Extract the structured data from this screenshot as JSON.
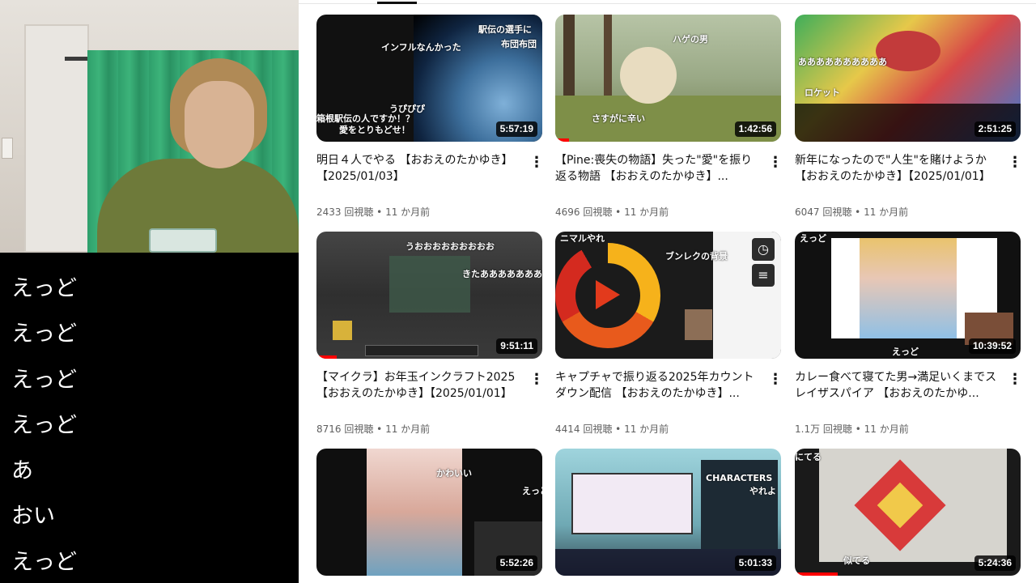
{
  "chat": {
    "messages": [
      "えっど",
      "えっど",
      "えっど",
      "えっど",
      "あ",
      "おい",
      "えっど"
    ]
  },
  "videos": [
    {
      "title": "明日４人でやる 【おおえのたかゆき】【2025/01/03】",
      "views": "2433 回視聴",
      "age": "11 か月前",
      "duration": "5:57:19",
      "overlay": [
        "インフルなんかった",
        "駅伝の選手に",
        "布団布団",
        "うぴぴぴ",
        "箱根駅伝の人ですか！？",
        "愛をとりもどせ！"
      ]
    },
    {
      "title": "【Pine:喪失の物語】失った\"愛\"を振り返る物語 【おおえのたかゆき】...",
      "views": "4696 回視聴",
      "age": "11 か月前",
      "duration": "1:42:56",
      "overlay": [
        "ハゲの男",
        "さすがに辛い"
      ]
    },
    {
      "title": "新年になったので\"人生\"を賭けようか【おおえのたかゆき】【2025/01/01】",
      "views": "6047 回視聴",
      "age": "11 か月前",
      "duration": "2:51:25",
      "overlay": [
        "ああああああああああ",
        "ロケット"
      ]
    },
    {
      "title": "【マイクラ】お年玉インクラフト2025【おおえのたかゆき】【2025/01/01】",
      "views": "8716 回視聴",
      "age": "11 か月前",
      "duration": "9:51:11",
      "overlay": [
        "うおおおおおおおおお",
        "きたあああああああ"
      ]
    },
    {
      "title": "キャプチャで振り返る2025年カウントダウン配信 【おおえのたかゆき】...",
      "views": "4414 回視聴",
      "age": "11 か月前",
      "duration": "",
      "overlay": [
        "ニマルやれ",
        "ブンレクの背景"
      ]
    },
    {
      "title": "カレー食べて寝てた男→満足いくまでスレイザスパイア 【おおえのたかゆ...",
      "views": "1.1万 回視聴",
      "age": "11 か月前",
      "duration": "10:39:52",
      "overlay": [
        "えっど",
        "えっど"
      ]
    },
    {
      "title": "",
      "views": "",
      "age": "",
      "duration": "5:52:26",
      "overlay": [
        "えっど",
        "かわいい"
      ]
    },
    {
      "title": "",
      "views": "",
      "age": "",
      "duration": "5:01:33",
      "overlay": [
        "CHARACTERS",
        "やれよ"
      ]
    },
    {
      "title": "",
      "views": "",
      "age": "",
      "duration": "5:24:36",
      "overlay": [
        "にてる",
        "似てる"
      ]
    }
  ],
  "icons": {
    "kebab": "more-vert-icon",
    "watch_later": "clock-icon",
    "add_to_queue": "queue-icon"
  },
  "colors": {
    "progress": "#ff0000",
    "title": "#0f0f0f",
    "meta": "#606060"
  }
}
